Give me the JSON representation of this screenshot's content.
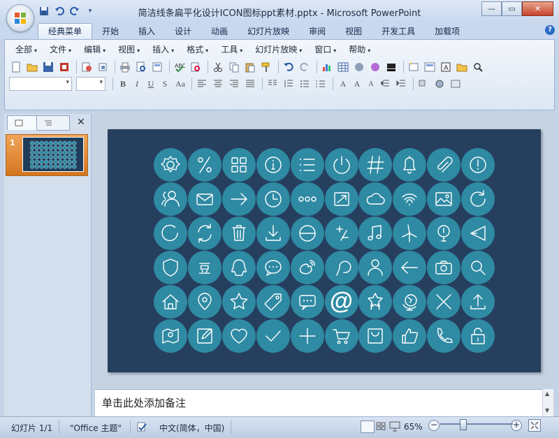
{
  "window": {
    "title": "简洁线条扁平化设计ICON图标ppt素材.pptx - Microsoft PowerPoint",
    "minimize": "—",
    "maximize": "▭",
    "close": "✕"
  },
  "quick_access": [
    "save-icon",
    "undo-icon",
    "redo-icon"
  ],
  "tabs": [
    "经典菜单",
    "开始",
    "插入",
    "设计",
    "动画",
    "幻灯片放映",
    "审阅",
    "视图",
    "开发工具",
    "加载项"
  ],
  "menu": [
    "全部",
    "文件",
    "编辑",
    "视图",
    "插入",
    "格式",
    "工具",
    "幻灯片放映",
    "窗口",
    "帮助"
  ],
  "panel": {
    "close": "✕",
    "slide_number": "1"
  },
  "slide": {
    "background": "#263f5f",
    "circle_color": "#2f8aa3",
    "icons": [
      [
        "gear",
        "percent",
        "grid",
        "info",
        "list",
        "power",
        "hash",
        "bell",
        "paperclip",
        "alert"
      ],
      [
        "user",
        "mail",
        "arrow-right",
        "clock",
        "dots",
        "external-box",
        "cloud",
        "wifi",
        "image",
        "refresh"
      ],
      [
        "rotate-left",
        "sync",
        "trash",
        "download",
        "e-circle",
        "plus-minus",
        "music",
        "windmill",
        "thermometer",
        "send"
      ],
      [
        "shield",
        "dou-char",
        "qq",
        "chat",
        "weibo",
        "lookup",
        "person",
        "arrow-left",
        "camera",
        "search"
      ],
      [
        "home",
        "location",
        "star",
        "tag",
        "speech",
        "at",
        "badge",
        "globe",
        "close-x",
        "upload"
      ],
      [
        "map",
        "edit",
        "heart",
        "check",
        "plus",
        "cart",
        "bag",
        "thumbs-up",
        "phone",
        "lock"
      ]
    ],
    "at_label": "@",
    "dou_label": "豆"
  },
  "notes": {
    "placeholder": "单击此处添加备注"
  },
  "status": {
    "slide": "幻灯片 1/1",
    "theme": "\"Office 主题\"",
    "language": "中文(简体，中国)",
    "zoom": "65%",
    "zoom_level": 0.65
  }
}
